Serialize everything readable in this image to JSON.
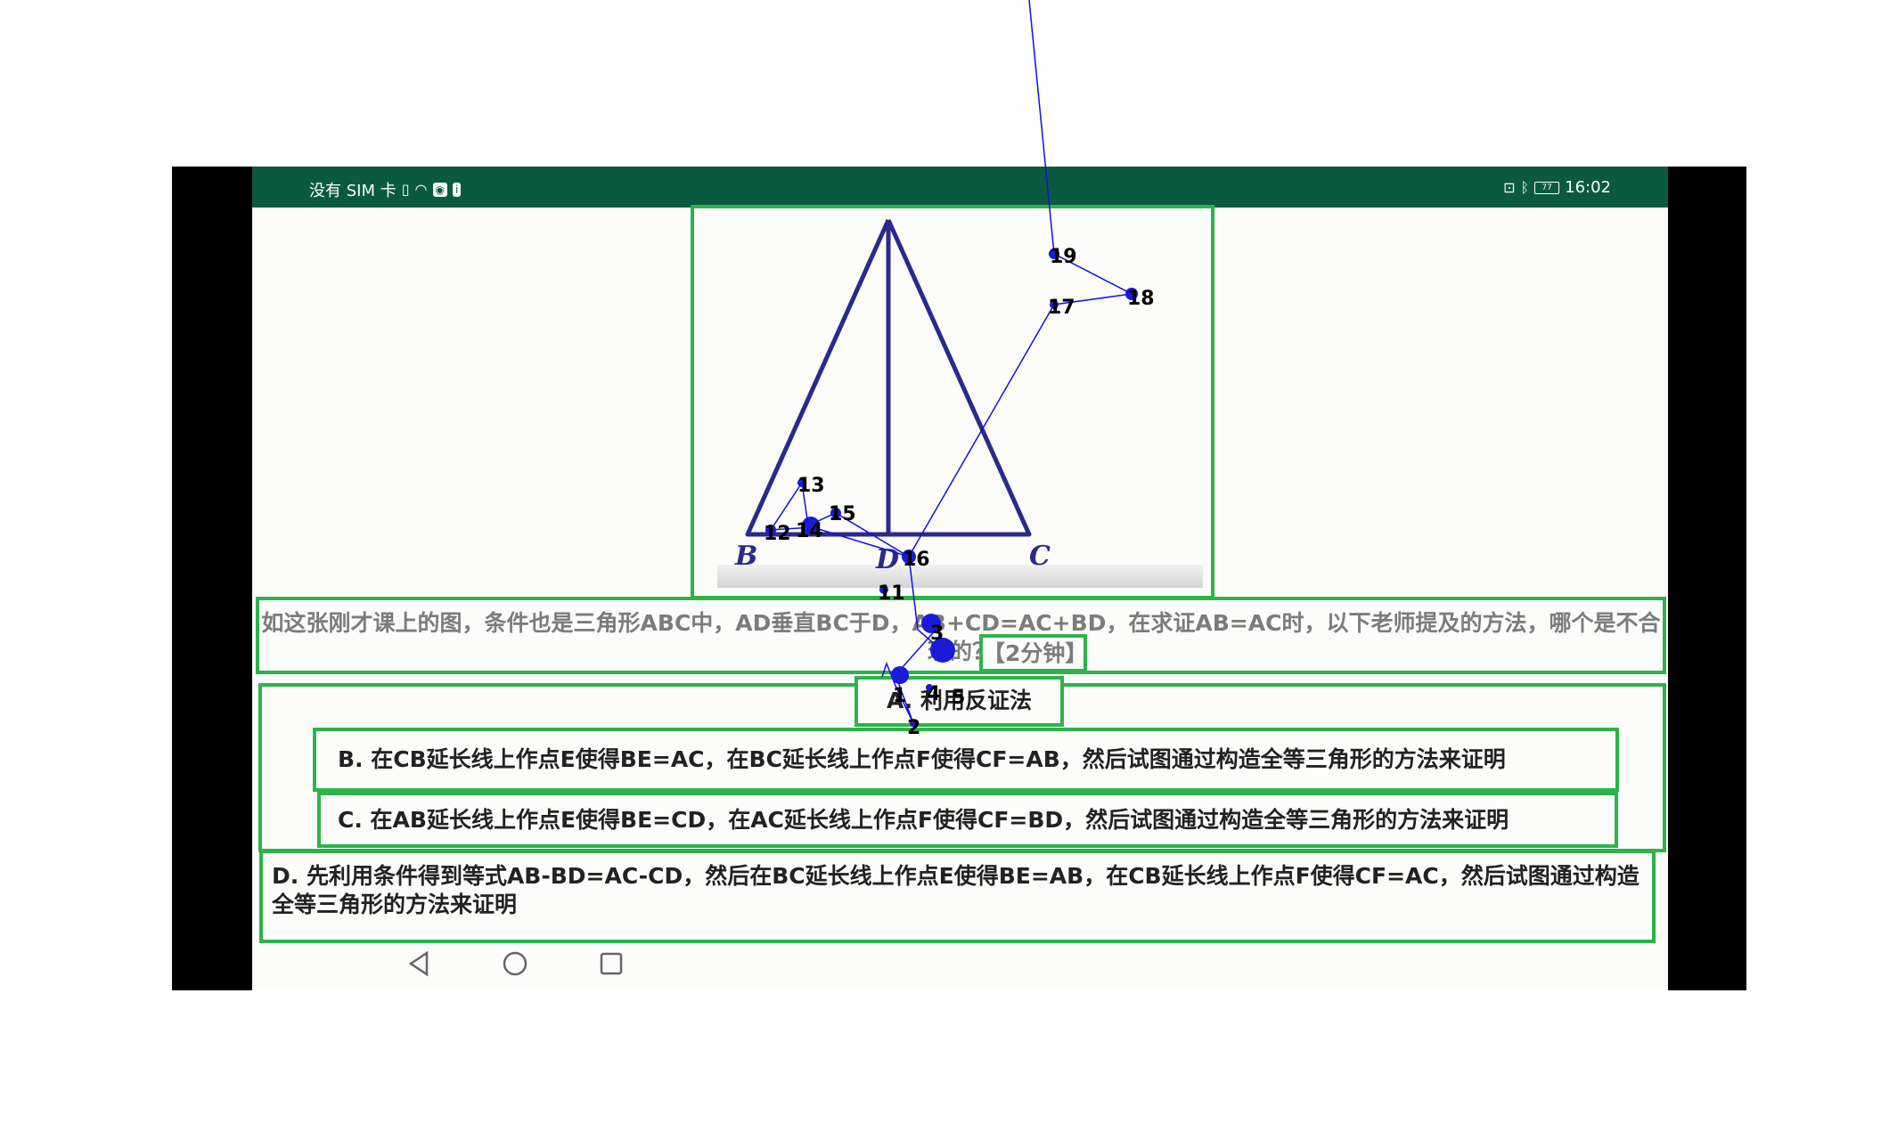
{
  "status_bar": {
    "left_text": "没有 SIM 卡",
    "right_text": "16:02",
    "battery_level": "77",
    "background": "#0a5a3f"
  },
  "figure": {
    "vertex_b": "B",
    "vertex_d": "D",
    "vertex_c": "C",
    "line_color": "#2a2a8a"
  },
  "question": {
    "text": "如这张刚才课上的图，条件也是三角形ABC中，AD垂直BC于D，AB+CD=AC+BD，在求证AB=AC时，以下老师提及的方法，哪个是不合理的？",
    "time_label": "【2分钟】"
  },
  "options": {
    "a": "A. 利用反证法",
    "b": "B. 在CB延长线上作点E使得BE=AC，在BC延长线上作点F使得CF=AB，然后试图通过构造全等三角形的方法来证明",
    "c": "C. 在AB延长线上作点E使得BE=CD，在AC延长线上作点F使得CF=BD，然后试图通过构造全等三角形的方法来证明",
    "d": "D. 先利用条件得到等式AB-BD=AC-CD，然后在BC延长线上作点E使得BE=AB，在CB延长线上作点F使得CF=AC，然后试图通过构造全等三角形的方法来证明"
  },
  "nav": {
    "back_icon": "triangle-back-icon",
    "home_icon": "circle-home-icon",
    "recent_icon": "square-recent-icon"
  },
  "trajectory": {
    "labels": [
      "1",
      "2",
      "3",
      "4",
      "5",
      "11",
      "12",
      "13",
      "14",
      "15",
      "16",
      "17",
      "18",
      "19"
    ],
    "color": "#1010e0"
  },
  "accent_color": "#2db34a"
}
